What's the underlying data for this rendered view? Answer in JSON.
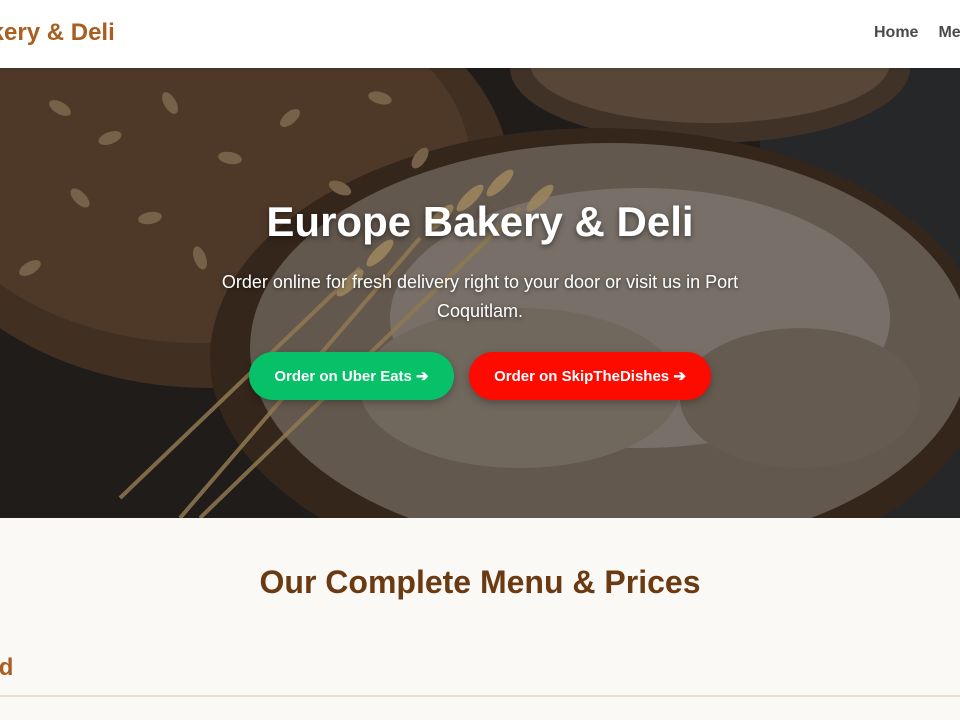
{
  "header": {
    "brand": "Bakery & Deli",
    "nav": [
      {
        "label": "Home"
      },
      {
        "label": "Me"
      }
    ]
  },
  "hero": {
    "title": "Europe Bakery & Deli",
    "subtitle": "Order online for fresh delivery right to your door or visit us in Port Coquitlam.",
    "buttons": {
      "uber": "Order on Uber Eats ➔",
      "skip": "Order on SkipTheDishes ➔"
    }
  },
  "menu": {
    "title": "Our Complete Menu & Prices",
    "first_category": "ead"
  },
  "colors": {
    "brand": "#a85f1f",
    "menu_title": "#6b3a12",
    "uber_green": "#06c167",
    "skip_red": "#fd0a00",
    "page_bg": "#fbf9f5"
  }
}
